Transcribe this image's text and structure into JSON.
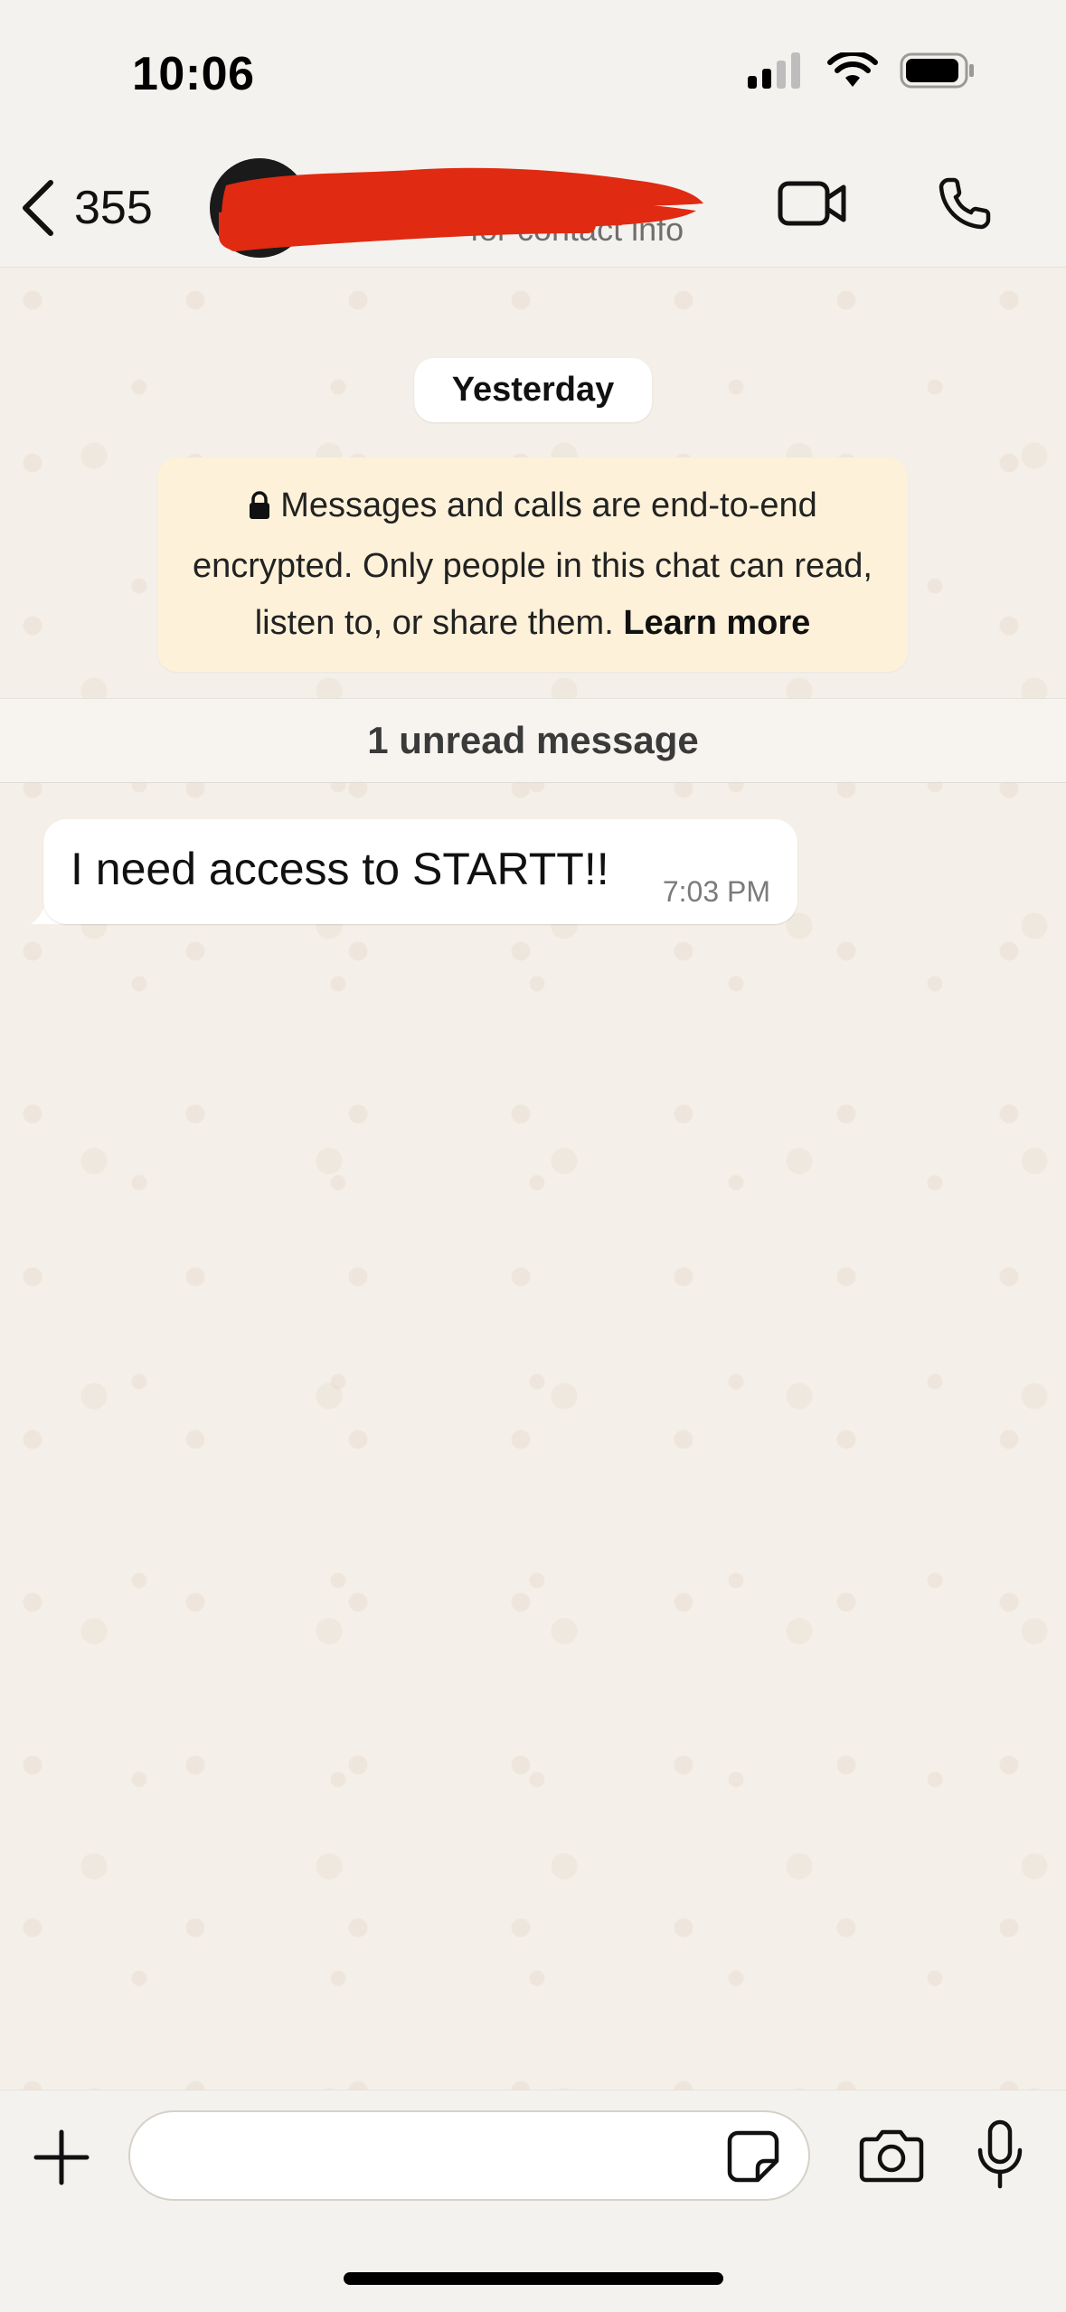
{
  "status_bar": {
    "time": "10:06"
  },
  "header": {
    "back_count": "355",
    "contact_name": "",
    "contact_sub": "for contact info",
    "redaction_color": "#e02a12"
  },
  "chat": {
    "date_label": "Yesterday",
    "encryption_notice": {
      "text": "Messages and calls are end-to-end encrypted. Only people in this chat can read, listen to, or share them.",
      "learn_more": "Learn more"
    },
    "unread_label": "1 unread message",
    "messages": [
      {
        "text": "I need access to STARTT!!",
        "time": "7:03 PM",
        "direction": "incoming"
      }
    ]
  },
  "input": {
    "placeholder": ""
  },
  "icons": {
    "back": "chevron-left-icon",
    "video": "video-camera-icon",
    "call": "phone-icon",
    "plus": "plus-icon",
    "sticker": "sticker-icon",
    "camera": "camera-icon",
    "mic": "microphone-icon",
    "lock": "lock-icon"
  }
}
